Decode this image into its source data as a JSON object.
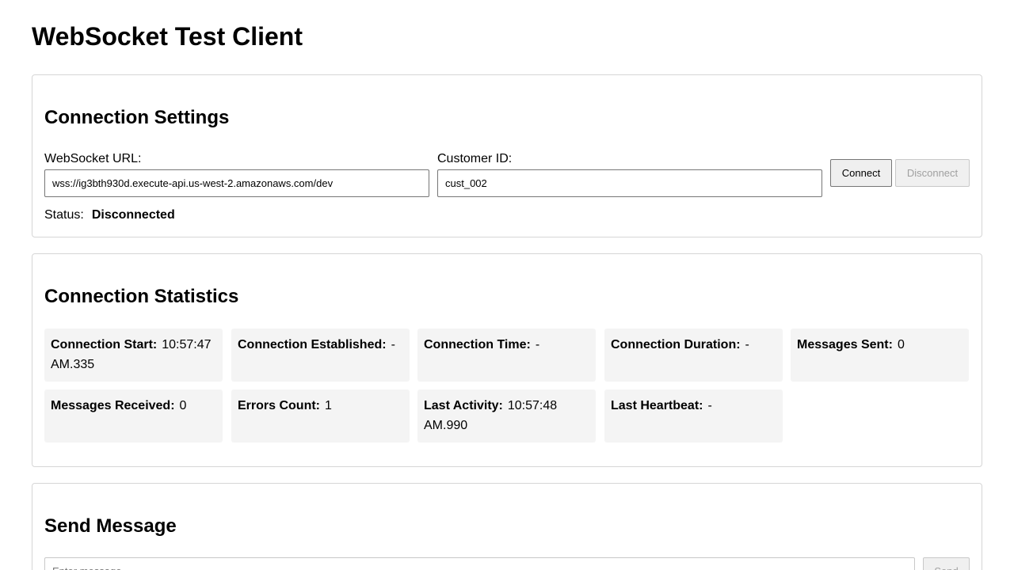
{
  "page": {
    "title": "WebSocket Test Client"
  },
  "settings": {
    "heading": "Connection Settings",
    "url_label": "WebSocket URL:",
    "url_value": "wss://ig3bth930d.execute-api.us-west-2.amazonaws.com/dev",
    "customer_label": "Customer ID:",
    "customer_value": "cust_002",
    "connect_label": "Connect",
    "disconnect_label": "Disconnect",
    "disconnect_enabled": false,
    "status_label": "Status:",
    "status_value": "Disconnected"
  },
  "stats": {
    "heading": "Connection Statistics",
    "items": [
      {
        "label": "Connection Start:",
        "value": "10:57:47 AM.335"
      },
      {
        "label": "Connection Established:",
        "value": "-"
      },
      {
        "label": "Connection Time:",
        "value": "-"
      },
      {
        "label": "Connection Duration:",
        "value": "-"
      },
      {
        "label": "Messages Sent:",
        "value": "0"
      },
      {
        "label": "Messages Received:",
        "value": "0"
      },
      {
        "label": "Errors Count:",
        "value": "1"
      },
      {
        "label": "Last Activity:",
        "value": "10:57:48 AM.990"
      },
      {
        "label": "Last Heartbeat:",
        "value": "-"
      }
    ]
  },
  "send": {
    "heading": "Send Message",
    "placeholder": "Enter message...",
    "send_label": "Send",
    "send_enabled": false
  }
}
